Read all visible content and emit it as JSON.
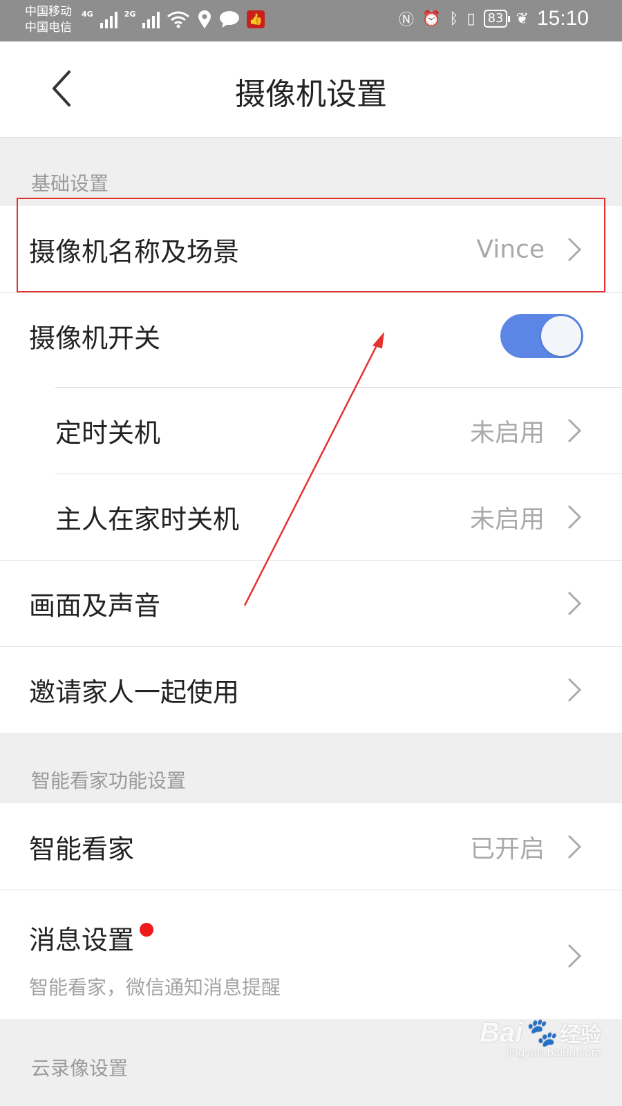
{
  "status_bar": {
    "carrier1": "中国移动",
    "carrier2": "中国电信",
    "net1": "4G",
    "net2": "2G",
    "battery": "83",
    "time": "15:10"
  },
  "header": {
    "title": "摄像机设置",
    "back_icon": "chevron-left-icon"
  },
  "sections": {
    "basic": "基础设置",
    "smart": "智能看家功能设置",
    "cloud": "云录像设置"
  },
  "basic_rows": {
    "name_scene": {
      "label": "摄像机名称及场景",
      "value": "Vince"
    },
    "camera_switch": {
      "label": "摄像机开关",
      "on": true
    },
    "timed_off": {
      "label": "定时关机",
      "value": "未启用"
    },
    "home_off": {
      "label": "主人在家时关机",
      "value": "未启用"
    },
    "picture_sound": {
      "label": "画面及声音"
    },
    "invite_family": {
      "label": "邀请家人一起使用"
    }
  },
  "smart_rows": {
    "smart_home": {
      "label": "智能看家",
      "value": "已开启"
    },
    "message_settings": {
      "label": "消息设置",
      "sublabel": "智能看家，微信通知消息提醒"
    }
  },
  "watermark": {
    "brand": "Bai",
    "brand_tail": "经验",
    "url": "jingyan.baidu.com"
  },
  "colors": {
    "accent_toggle": "#5b86e5",
    "annotation_red": "#e4322e",
    "badge_red": "#ef1a1a"
  }
}
